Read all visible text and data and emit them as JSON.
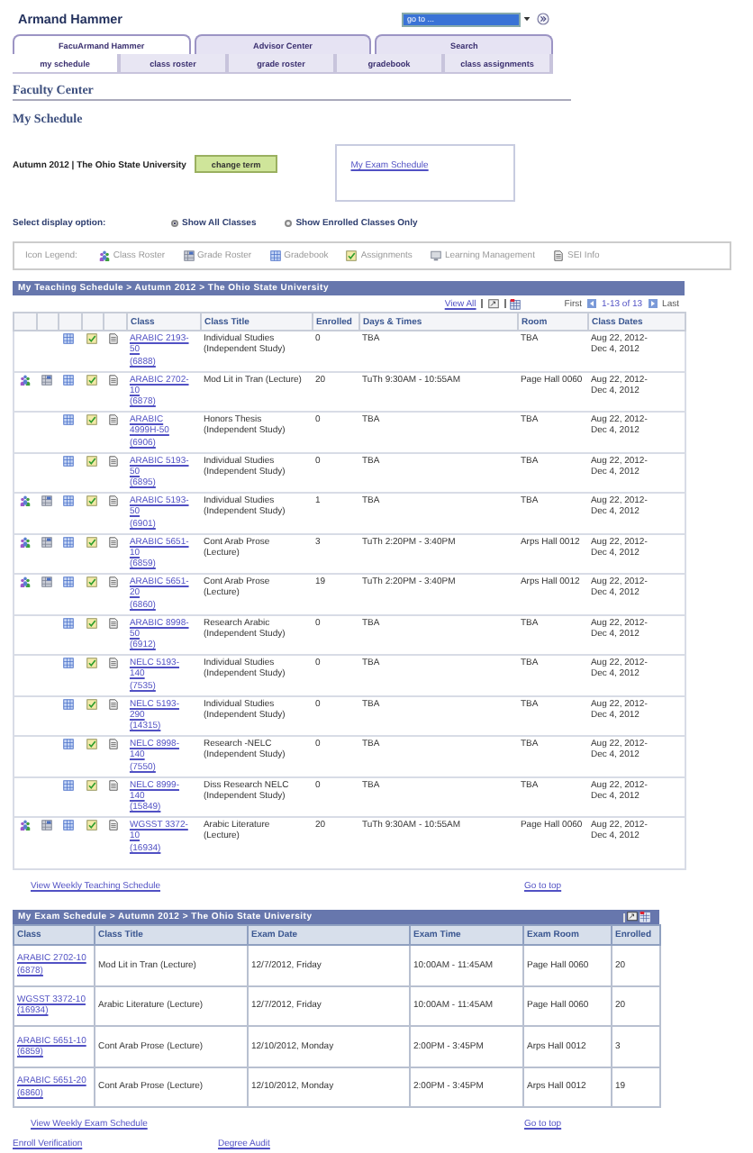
{
  "user_name": "Armand Hammer",
  "goto": {
    "placeholder": "go to ..."
  },
  "tabs": [
    {
      "label": "FacuArmand Hammer",
      "selected": true
    },
    {
      "label": "Advisor Center",
      "selected": false
    },
    {
      "label": "Search",
      "selected": false
    }
  ],
  "subtabs": [
    {
      "label": "my schedule",
      "selected": true
    },
    {
      "label": "class roster",
      "selected": false
    },
    {
      "label": "grade roster",
      "selected": false
    },
    {
      "label": "gradebook",
      "selected": false
    },
    {
      "label": "class assignments",
      "selected": false
    }
  ],
  "section_title": "Faculty Center",
  "page_title": "My Schedule",
  "term": "Autumn 2012 | The Ohio State University",
  "change_term": "change term",
  "exam_schedule_link": "My Exam Schedule",
  "display_option": {
    "label": "Select display option:",
    "options": [
      {
        "label": "Show All Classes",
        "selected": true
      },
      {
        "label": "Show Enrolled Classes Only",
        "selected": false
      }
    ]
  },
  "icon_legend": {
    "label": "Icon Legend:",
    "items": [
      {
        "kind": "roster",
        "label": "Class Roster"
      },
      {
        "kind": "grades",
        "label": "Grade Roster"
      },
      {
        "kind": "gradebook",
        "label": "Gradebook"
      },
      {
        "kind": "assignments",
        "label": "Assignments"
      },
      {
        "kind": "learning",
        "label": "Learning Management"
      },
      {
        "kind": "sei",
        "label": "SEI Info"
      }
    ]
  },
  "teaching": {
    "title": "My Teaching Schedule > Autumn 2012 > The Ohio State University",
    "view_all": "View All",
    "first": "First",
    "range": "1-13 of 13",
    "last": "Last",
    "columns": [
      "Class",
      "Class Title",
      "Enrolled",
      "Days & Times",
      "Room",
      "Class Dates"
    ],
    "rows": [
      {
        "roster": false,
        "grades": false,
        "class": "ARABIC 2193-50",
        "section": "(6888)",
        "title": "Individual Studies (Independent Study)",
        "enrolled": "0",
        "days": "TBA",
        "room": "TBA",
        "dates": "Aug 22, 2012-Dec 4, 2012"
      },
      {
        "roster": true,
        "grades": true,
        "class": "ARABIC 2702-10",
        "section": "(6878)",
        "title": "Mod Lit in Tran (Lecture)",
        "enrolled": "20",
        "days": "TuTh 9:30AM - 10:55AM",
        "room": "Page Hall 0060",
        "dates": "Aug 22, 2012-Dec 4, 2012"
      },
      {
        "roster": false,
        "grades": false,
        "class": "ARABIC 4999H-50",
        "section": "(6906)",
        "title": "Honors Thesis (Independent Study)",
        "enrolled": "0",
        "days": "TBA",
        "room": "TBA",
        "dates": "Aug 22, 2012-Dec 4, 2012"
      },
      {
        "roster": false,
        "grades": false,
        "class": "ARABIC 5193-50",
        "section": "(6895)",
        "title": "Individual Studies (Independent Study)",
        "enrolled": "0",
        "days": "TBA",
        "room": "TBA",
        "dates": "Aug 22, 2012-Dec 4, 2012"
      },
      {
        "roster": true,
        "grades": true,
        "class": "ARABIC 5193-50",
        "section": "(6901)",
        "title": "Individual Studies (Independent Study)",
        "enrolled": "1",
        "days": "TBA",
        "room": "TBA",
        "dates": "Aug 22, 2012-Dec 4, 2012"
      },
      {
        "roster": true,
        "grades": true,
        "class": "ARABIC 5651-10",
        "section": "(6859)",
        "title": "Cont Arab Prose (Lecture)",
        "enrolled": "3",
        "days": "TuTh 2:20PM - 3:40PM",
        "room": "Arps Hall 0012",
        "dates": "Aug 22, 2012-Dec 4, 2012"
      },
      {
        "roster": true,
        "grades": true,
        "class": "ARABIC 5651-20",
        "section": "(6860)",
        "title": "Cont Arab Prose (Lecture)",
        "enrolled": "19",
        "days": "TuTh 2:20PM - 3:40PM",
        "room": "Arps Hall 0012",
        "dates": "Aug 22, 2012-Dec 4, 2012"
      },
      {
        "roster": false,
        "grades": false,
        "class": "ARABIC 8998-50",
        "section": "(6912)",
        "title": "Research Arabic (Independent Study)",
        "enrolled": "0",
        "days": "TBA",
        "room": "TBA",
        "dates": "Aug 22, 2012-Dec 4, 2012"
      },
      {
        "roster": false,
        "grades": false,
        "class": "NELC 5193-140",
        "section": "(7535)",
        "title": "Individual Studies (Independent Study)",
        "enrolled": "0",
        "days": "TBA",
        "room": "TBA",
        "dates": "Aug 22, 2012-Dec 4, 2012"
      },
      {
        "roster": false,
        "grades": false,
        "class": "NELC 5193-290",
        "section": "(14315)",
        "title": "Individual Studies (Independent Study)",
        "enrolled": "0",
        "days": "TBA",
        "room": "TBA",
        "dates": "Aug 22, 2012-Dec 4, 2012"
      },
      {
        "roster": false,
        "grades": false,
        "class": "NELC 8998-140",
        "section": "(7550)",
        "title": "Research -NELC (Independent Study)",
        "enrolled": "0",
        "days": "TBA",
        "room": "TBA",
        "dates": "Aug 22, 2012-Dec 4, 2012"
      },
      {
        "roster": false,
        "grades": false,
        "class": "NELC 8999-140",
        "section": "(15849)",
        "title": "Diss Research NELC (Independent Study)",
        "enrolled": "0",
        "days": "TBA",
        "room": "TBA",
        "dates": "Aug 22, 2012-Dec 4, 2012"
      },
      {
        "roster": true,
        "grades": true,
        "class": "WGSST 3372-10",
        "section": "(16934)",
        "title": "Arabic Literature (Lecture)",
        "enrolled": "20",
        "days": "TuTh 9:30AM - 10:55AM",
        "room": "Page Hall 0060",
        "dates": "Aug 22, 2012-Dec 4, 2012"
      }
    ],
    "weekly_link": "View Weekly Teaching Schedule",
    "top_link": "Go to top"
  },
  "exams": {
    "title": "My Exam Schedule > Autumn 2012 > The Ohio State University",
    "columns": [
      "Class",
      "Class Title",
      "Exam Date",
      "Exam Time",
      "Exam Room",
      "Enrolled"
    ],
    "rows": [
      {
        "class": "ARABIC 2702-10",
        "section": "(6878)",
        "title": "Mod Lit in Tran (Lecture)",
        "date": "12/7/2012, Friday",
        "time": "10:00AM - 11:45AM",
        "room": "Page Hall 0060",
        "enrolled": "20"
      },
      {
        "class": "WGSST 3372-10",
        "section": "(16934)",
        "title": "Arabic Literature (Lecture)",
        "date": "12/7/2012, Friday",
        "time": "10:00AM - 11:45AM",
        "room": "Page Hall 0060",
        "enrolled": "20"
      },
      {
        "class": "ARABIC 5651-10",
        "section": "(6859)",
        "title": "Cont Arab Prose (Lecture)",
        "date": "12/10/2012, Monday",
        "time": "2:00PM - 3:45PM",
        "room": "Arps Hall 0012",
        "enrolled": "3"
      },
      {
        "class": "ARABIC 5651-20",
        "section": "(6860)",
        "title": "Cont Arab Prose (Lecture)",
        "date": "12/10/2012, Monday",
        "time": "2:00PM - 3:45PM",
        "room": "Arps Hall 0012",
        "enrolled": "19"
      }
    ],
    "weekly_link": "View Weekly Exam Schedule",
    "top_link": "Go to top"
  },
  "footer_links": [
    "Enroll Verification",
    "Degree Audit"
  ]
}
